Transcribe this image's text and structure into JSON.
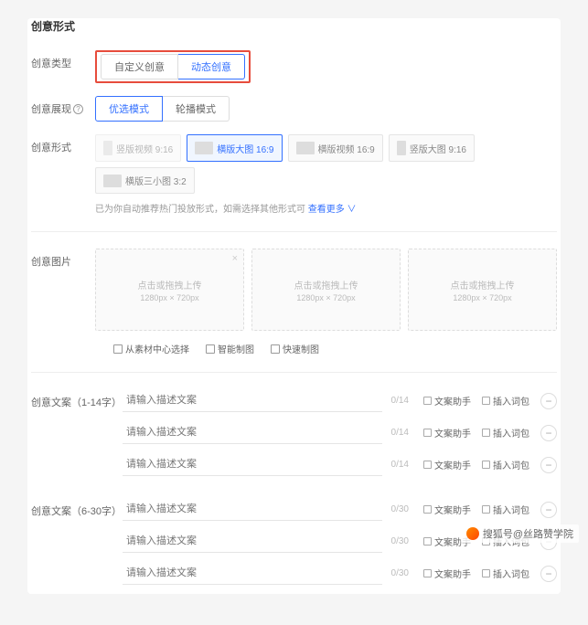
{
  "section1": {
    "title": "创意形式",
    "creative_type": {
      "label": "创意类型",
      "tabs": [
        "自定义创意",
        "动态创意"
      ],
      "active": 1
    },
    "display_mode": {
      "label": "创意展现",
      "tabs": [
        "优选模式",
        "轮播模式"
      ],
      "active": 0
    },
    "creative_form": {
      "label": "创意形式",
      "formats": [
        {
          "label": "竖版视频 9:16",
          "active": false,
          "disabled": true,
          "tall": true
        },
        {
          "label": "横版大图 16:9",
          "active": true,
          "disabled": false,
          "tall": false
        },
        {
          "label": "横版视频 16:9",
          "active": false,
          "disabled": false,
          "tall": false
        },
        {
          "label": "竖版大图 9:16",
          "active": false,
          "disabled": false,
          "tall": true
        },
        {
          "label": "横版三小图 3:2",
          "active": false,
          "disabled": false,
          "tall": false
        }
      ],
      "hint_prefix": "已为你自动推荐热门投放形式，如需选择其他形式可",
      "hint_link": "查看更多 ∨"
    }
  },
  "section2": {
    "title": "创意图片",
    "upload": {
      "text": "点击或拖拽上传",
      "dim": "1280px × 720px"
    },
    "tools": [
      {
        "label": "从素材中心选择"
      },
      {
        "label": "智能制图"
      },
      {
        "label": "快速制图"
      }
    ]
  },
  "copy_short": {
    "title": "创意文案（1-14字）",
    "placeholder": "请输入描述文案",
    "count": "0/14",
    "actions": [
      "文案助手",
      "插入词包"
    ],
    "rows": 3
  },
  "copy_long": {
    "title": "创意文案（6-30字）",
    "placeholder": "请输入描述文案",
    "count": "0/30",
    "actions": [
      "文案助手",
      "插入词包"
    ],
    "rows": 3
  },
  "watermark": "搜狐号@丝路赞学院"
}
